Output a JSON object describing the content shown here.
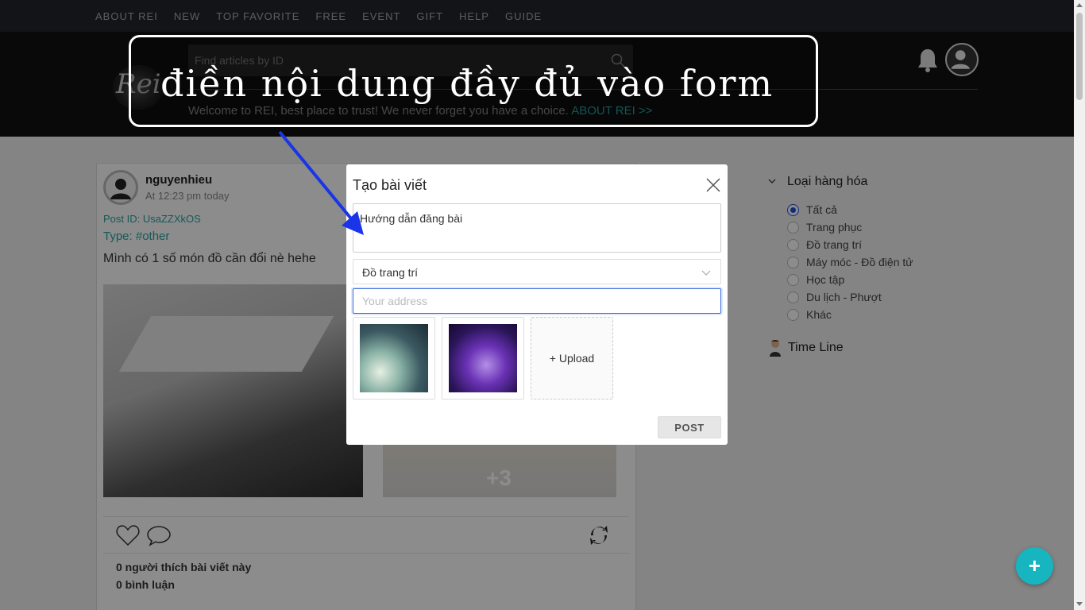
{
  "topnav": {
    "items": [
      "ABOUT REI",
      "NEW",
      "TOP FAVORITE",
      "FREE",
      "EVENT",
      "GIFT",
      "HELP",
      "GUIDE"
    ]
  },
  "header": {
    "logo_text": "Rei",
    "search_placeholder": "Find articles by ID",
    "welcome_text": "Welcome to REI, best place to trust! We never forget you have a choice. ",
    "welcome_link": "ABOUT REI >>"
  },
  "annotation": {
    "text": "điền nội dung đầy đủ vào form"
  },
  "post": {
    "username": "nguyenhieu",
    "time": "At 12:23 pm today",
    "post_id": "Post ID: UsaZZXkOS",
    "type": "Type: #other",
    "content": "Mình có 1 số món đồ cần đổi nè hehe",
    "more_images": "+3",
    "likes": "0 người thích bài viết này",
    "comments": "0 bình luận"
  },
  "sidebar": {
    "title": "Loại hàng hóa",
    "options": [
      "Tất cả",
      "Trang phục",
      "Đồ trang trí",
      "Máy móc - Đồ điện tử",
      "Học tập",
      "Du lịch - Phượt",
      "Khác"
    ],
    "selected": "Tất cả",
    "timeline_label": "Time Line"
  },
  "modal": {
    "title": "Tạo bài viết",
    "description_value": "Hướng dẫn đăng bài",
    "category_value": "Đồ trang trí",
    "address_placeholder": "Your address",
    "upload_label": "+ Upload",
    "post_button": "POST"
  },
  "fab": {
    "label": "+"
  },
  "colors": {
    "accent": "#17b5c0",
    "link": "#2aa3a3",
    "radio_selected": "#1f4fe0",
    "arrow": "#1a35e8"
  }
}
